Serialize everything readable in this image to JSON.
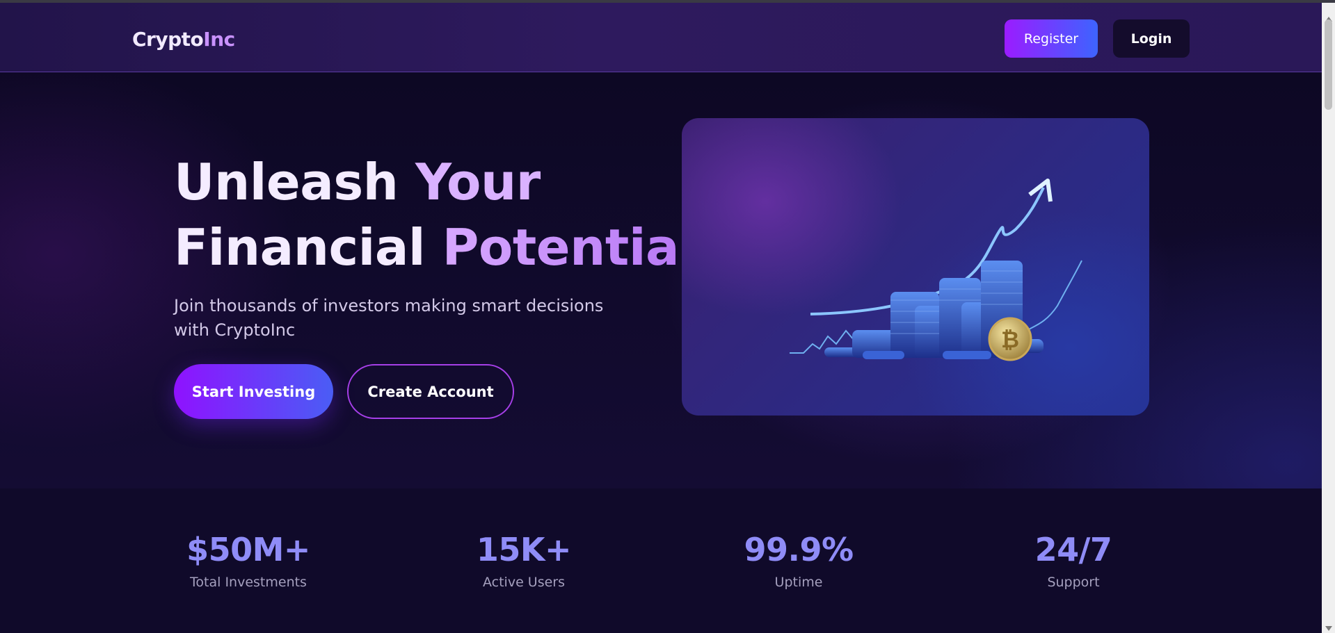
{
  "navbar": {
    "logo_part1": "Crypto",
    "logo_part2": "Inc",
    "register_label": "Register",
    "login_label": "Login"
  },
  "hero": {
    "title_line1_a": "Unleash ",
    "title_line1_b": "Your",
    "title_line2_a": "Financial ",
    "title_line2_b": "Potential",
    "subtitle": "Join thousands of investors making smart decisions with CryptoInc",
    "start_label": "Start Investing",
    "create_label": "Create Account",
    "coin_symbol": "₿"
  },
  "stats": [
    {
      "value": "$50M+",
      "label": "Total Investments"
    },
    {
      "value": "15K+",
      "label": "Active Users"
    },
    {
      "value": "99.9%",
      "label": "Uptime"
    },
    {
      "value": "24/7",
      "label": "Support"
    }
  ],
  "colors": {
    "accent_purple": "#9b1cff",
    "accent_blue": "#3d64ff",
    "stat_value": "#8f8cf7",
    "background": "#100a2a"
  }
}
